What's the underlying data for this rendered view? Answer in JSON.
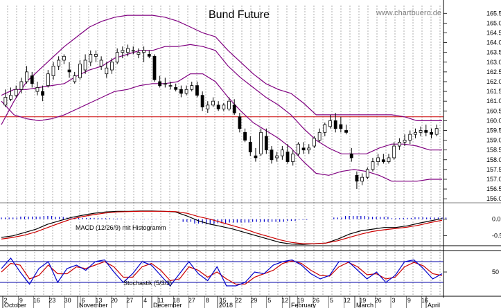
{
  "window": {
    "title": "Bund Future",
    "watermark": "www.chartbuero.de"
  },
  "colors": {
    "candle": "#000000",
    "band": "#800080",
    "resistance": "#cc0000",
    "macd": "#000000",
    "signal": "#cc0000",
    "hist": "#0000cc",
    "stochK": "#0000cc",
    "stochD": "#cc0000",
    "grid": "#999999"
  },
  "chart_data": [
    {
      "type": "candlestick",
      "title": "Bund Future",
      "ylim": [
        155.9,
        165.9
      ],
      "yticks": [
        "165.5",
        "165.0",
        "164.5",
        "164.0",
        "163.5",
        "163.0",
        "162.5",
        "162.0",
        "161.5",
        "161.0",
        "160.5",
        "160.0",
        "159.5",
        "159.0",
        "158.5",
        "158.0",
        "157.5",
        "157.0",
        "156.5",
        "156.0"
      ],
      "resistance": 160.2,
      "series": [
        {
          "type": "line",
          "values": [
            161.3,
            161.6,
            161.6,
            161.7,
            161.8,
            161.9,
            162.3,
            162.6,
            162.8,
            163.2,
            163.4,
            163.6,
            163.6,
            163.8,
            163.8,
            163.9,
            163.8,
            163.6,
            162.8,
            162.2,
            161.7,
            161.2,
            160.8,
            160.3,
            159.6,
            159.0,
            158.6,
            158.3,
            158.3,
            158.3,
            158.6,
            158.8,
            158.8,
            158.7,
            158.5,
            158.5
          ]
        },
        {
          "type": "line",
          "values": [
            159.8,
            161.0,
            162.0,
            162.6,
            163.2,
            163.8,
            164.3,
            164.8,
            165.1,
            165.3,
            165.4,
            165.4,
            165.4,
            165.3,
            165.1,
            164.8,
            164.5,
            164.3,
            163.6,
            163.0,
            162.4,
            161.9,
            161.6,
            161.4,
            160.9,
            160.3,
            160.3,
            160.3,
            160.3,
            160.3,
            160.3,
            160.3,
            160.2,
            160.0,
            160.0,
            160.0
          ]
        },
        {
          "type": "line",
          "values": [
            161.0,
            160.3,
            160.1,
            160.0,
            160.1,
            160.3,
            160.6,
            160.9,
            161.2,
            161.5,
            161.6,
            161.8,
            161.9,
            161.9,
            162.0,
            162.4,
            162.4,
            162.0,
            161.2,
            160.5,
            159.9,
            159.5,
            159.1,
            158.6,
            157.9,
            157.3,
            157.2,
            157.4,
            157.5,
            157.4,
            157.2,
            156.9,
            156.9,
            156.9,
            157.0,
            157.0
          ]
        }
      ],
      "candles": [
        [
          160.8,
          161.6,
          160.7,
          161.2
        ],
        [
          161.1,
          161.7,
          161.0,
          161.3
        ],
        [
          161.3,
          161.8,
          161.2,
          161.6
        ],
        [
          161.6,
          162.2,
          161.4,
          162.0
        ],
        [
          162.0,
          162.8,
          161.9,
          162.5
        ],
        [
          162.3,
          162.5,
          161.7,
          161.9
        ],
        [
          161.5,
          162.0,
          161.3,
          161.7
        ],
        [
          161.5,
          161.8,
          161.0,
          161.3
        ],
        [
          161.8,
          162.6,
          161.7,
          162.4
        ],
        [
          162.3,
          163.0,
          162.1,
          162.8
        ],
        [
          162.8,
          163.3,
          162.6,
          163.1
        ],
        [
          163.1,
          163.4,
          162.9,
          163.3
        ],
        [
          162.6,
          163.0,
          162.2,
          162.5
        ],
        [
          162.0,
          162.5,
          161.9,
          162.3
        ],
        [
          162.2,
          163.1,
          162.1,
          162.9
        ],
        [
          162.6,
          163.4,
          162.4,
          163.1
        ],
        [
          163.0,
          163.6,
          162.8,
          163.4
        ],
        [
          163.3,
          163.6,
          163.0,
          163.4
        ],
        [
          162.8,
          163.3,
          162.6,
          163.1
        ],
        [
          162.4,
          163.0,
          162.2,
          162.7
        ],
        [
          162.6,
          163.2,
          162.4,
          163.0
        ],
        [
          163.0,
          163.7,
          162.9,
          163.5
        ],
        [
          163.5,
          163.8,
          163.2,
          163.6
        ],
        [
          163.5,
          163.9,
          163.3,
          163.7
        ],
        [
          163.6,
          163.8,
          163.4,
          163.6
        ],
        [
          163.4,
          163.7,
          163.2,
          163.5
        ],
        [
          163.5,
          163.8,
          163.0,
          163.6
        ],
        [
          163.4,
          163.6,
          163.2,
          163.3
        ],
        [
          163.3,
          163.4,
          162.0,
          162.1
        ],
        [
          162.0,
          162.3,
          161.7,
          161.8
        ],
        [
          161.9,
          162.2,
          161.7,
          161.9
        ],
        [
          161.8,
          162.0,
          161.6,
          161.8
        ],
        [
          161.7,
          161.9,
          161.5,
          161.6
        ],
        [
          161.6,
          161.8,
          161.2,
          161.4
        ],
        [
          161.4,
          161.8,
          161.3,
          161.6
        ],
        [
          161.6,
          162.0,
          161.5,
          161.8
        ],
        [
          161.8,
          162.0,
          161.2,
          161.3
        ],
        [
          161.3,
          161.5,
          160.5,
          160.7
        ],
        [
          160.6,
          161.0,
          160.4,
          160.8
        ],
        [
          160.8,
          161.2,
          160.7,
          161.0
        ],
        [
          160.8,
          161.0,
          160.5,
          160.6
        ],
        [
          160.6,
          160.9,
          160.5,
          160.8
        ],
        [
          160.6,
          161.2,
          160.5,
          161.0
        ],
        [
          160.8,
          161.1,
          160.3,
          160.4
        ],
        [
          160.2,
          160.4,
          159.4,
          159.6
        ],
        [
          159.4,
          159.6,
          158.9,
          159.0
        ],
        [
          158.9,
          159.2,
          158.2,
          158.4
        ],
        [
          158.2,
          158.6,
          157.9,
          158.1
        ],
        [
          158.3,
          159.6,
          158.2,
          159.4
        ],
        [
          159.2,
          159.6,
          158.3,
          158.5
        ],
        [
          158.5,
          158.7,
          157.8,
          158.0
        ],
        [
          158.1,
          158.4,
          157.9,
          158.2
        ],
        [
          158.2,
          158.7,
          158.0,
          158.5
        ],
        [
          158.4,
          158.8,
          157.8,
          157.9
        ],
        [
          157.9,
          158.5,
          157.7,
          158.3
        ],
        [
          158.3,
          158.9,
          158.2,
          158.8
        ],
        [
          158.6,
          158.9,
          158.3,
          158.5
        ],
        [
          158.5,
          158.8,
          158.3,
          158.6
        ],
        [
          158.7,
          159.2,
          158.6,
          159.1
        ],
        [
          159.0,
          159.6,
          158.9,
          159.4
        ],
        [
          159.4,
          159.9,
          159.2,
          159.8
        ],
        [
          159.7,
          160.3,
          159.6,
          160.0
        ],
        [
          160.0,
          160.4,
          159.4,
          159.6
        ],
        [
          159.8,
          160.2,
          159.4,
          159.6
        ],
        [
          159.5,
          159.8,
          159.3,
          159.4
        ],
        [
          158.3,
          158.6,
          157.9,
          158.1
        ],
        [
          157.2,
          157.4,
          156.5,
          156.9
        ],
        [
          156.9,
          157.3,
          156.7,
          157.1
        ],
        [
          157.1,
          157.6,
          157.0,
          157.5
        ],
        [
          157.5,
          158.1,
          157.4,
          157.9
        ],
        [
          157.9,
          158.3,
          157.7,
          158.1
        ],
        [
          158.0,
          158.3,
          157.8,
          157.9
        ],
        [
          157.9,
          158.3,
          157.8,
          158.1
        ],
        [
          158.1,
          158.9,
          158.0,
          158.7
        ],
        [
          158.7,
          159.1,
          158.5,
          158.9
        ],
        [
          158.9,
          159.3,
          158.7,
          159.0
        ],
        [
          159.0,
          159.5,
          158.8,
          159.3
        ],
        [
          159.3,
          159.6,
          159.1,
          159.4
        ],
        [
          159.4,
          159.7,
          159.2,
          159.5
        ],
        [
          159.5,
          159.8,
          159.2,
          159.4
        ],
        [
          159.4,
          159.6,
          159.1,
          159.3
        ],
        [
          159.3,
          159.8,
          159.2,
          159.6
        ]
      ]
    },
    {
      "type": "macd",
      "label": "MACD (12/26/9) mit Histogramm",
      "yticks": [
        "0.0",
        "-0.5"
      ],
      "ylim": [
        -0.8,
        0.35
      ],
      "macd": [
        -0.55,
        -0.5,
        -0.4,
        -0.3,
        -0.15,
        -0.05,
        0.05,
        0.12,
        0.18,
        0.22,
        0.24,
        0.24,
        0.25,
        0.25,
        0.24,
        0.22,
        0.1,
        -0.05,
        -0.15,
        -0.22,
        -0.3,
        -0.4,
        -0.5,
        -0.6,
        -0.7,
        -0.75,
        -0.76,
        -0.74,
        -0.72,
        -0.6,
        -0.45,
        -0.35,
        -0.3,
        -0.25,
        -0.25,
        -0.2,
        -0.12,
        -0.05,
        0.02
      ],
      "signal": [
        -0.6,
        -0.55,
        -0.48,
        -0.38,
        -0.25,
        -0.12,
        0.0,
        0.08,
        0.14,
        0.19,
        0.22,
        0.23,
        0.24,
        0.24,
        0.24,
        0.23,
        0.18,
        0.08,
        0.0,
        -0.1,
        -0.2,
        -0.3,
        -0.42,
        -0.52,
        -0.62,
        -0.7,
        -0.74,
        -0.74,
        -0.72,
        -0.65,
        -0.55,
        -0.45,
        -0.37,
        -0.32,
        -0.28,
        -0.24,
        -0.18,
        -0.1,
        -0.03
      ],
      "hist": [
        0.05,
        0.05,
        0.08,
        0.08,
        0.1,
        0.07,
        0.05,
        0.04,
        0.04,
        0.03,
        0.02,
        0.01,
        0.01,
        0.01,
        0.0,
        -0.01,
        -0.08,
        -0.13,
        -0.15,
        -0.12,
        -0.1,
        -0.1,
        -0.08,
        -0.08,
        -0.08,
        -0.05,
        -0.02,
        0.0,
        0.0,
        0.05,
        0.1,
        0.1,
        0.07,
        0.07,
        0.03,
        0.04,
        0.06,
        0.05,
        0.05
      ]
    },
    {
      "type": "stochastic",
      "label": "Stochastik (5/3/3)",
      "yticks": [
        "50"
      ],
      "ylim": [
        0,
        100
      ],
      "ref_levels": [
        80,
        20
      ],
      "k": [
        60,
        90,
        50,
        15,
        60,
        80,
        20,
        60,
        70,
        55,
        80,
        85,
        50,
        20,
        45,
        80,
        70,
        40,
        10,
        45,
        80,
        45,
        25,
        65,
        10,
        10,
        20,
        50,
        45,
        70,
        80,
        85,
        70,
        45,
        30,
        40,
        80,
        80,
        55,
        30,
        50,
        20,
        40,
        80,
        85,
        60,
        30,
        45
      ],
      "d": [
        50,
        75,
        70,
        30,
        40,
        70,
        45,
        45,
        65,
        60,
        70,
        80,
        65,
        35,
        35,
        65,
        75,
        55,
        25,
        30,
        65,
        55,
        35,
        50,
        30,
        15,
        15,
        35,
        45,
        55,
        75,
        82,
        75,
        55,
        40,
        38,
        65,
        78,
        65,
        42,
        45,
        30,
        35,
        65,
        78,
        68,
        45,
        40
      ]
    }
  ],
  "x_axis": {
    "day_labels": [
      "2",
      "9",
      "16",
      "23",
      "30",
      "6",
      "13",
      "20",
      "27",
      "4",
      "11",
      "18",
      "27",
      "8",
      "15",
      "22",
      "29",
      "5",
      "12",
      "19",
      "26",
      "5",
      "12",
      "19",
      "26",
      "3",
      "9",
      "16",
      "23"
    ],
    "month_labels": [
      "October",
      "November",
      "December",
      "2018",
      "February",
      "March",
      "April"
    ],
    "last_label": "4"
  }
}
